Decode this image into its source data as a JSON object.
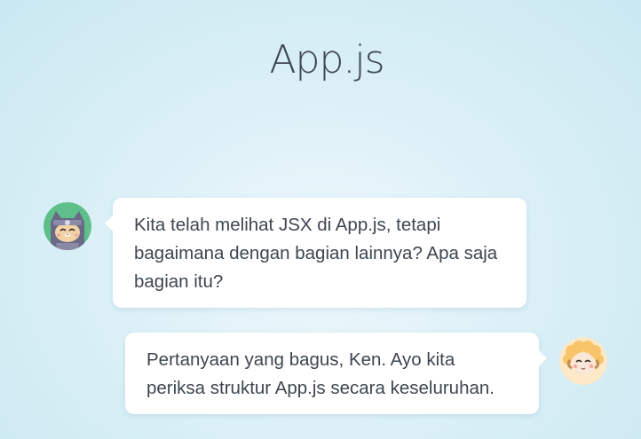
{
  "page": {
    "title": "App.js"
  },
  "messages": [
    {
      "speaker_icon": "cat-ninja-avatar-icon",
      "side": "left",
      "text": "Kita telah melihat JSX di App.js, tetapi bagaimana dengan bagian lainnya? Apa saja bagian itu?"
    },
    {
      "speaker_icon": "sheep-avatar-icon",
      "side": "right",
      "text": "Pertanyaan yang bagus, Ken. Ayo kita periksa struktur App.js secara keseluruhan."
    }
  ],
  "colors": {
    "background": "#dcf0f7",
    "bubble": "#ffffff",
    "text": "#3d4650",
    "cat_avatar_bg": "#5fbf8a",
    "sheep_avatar_bg": "#fde8c8"
  }
}
